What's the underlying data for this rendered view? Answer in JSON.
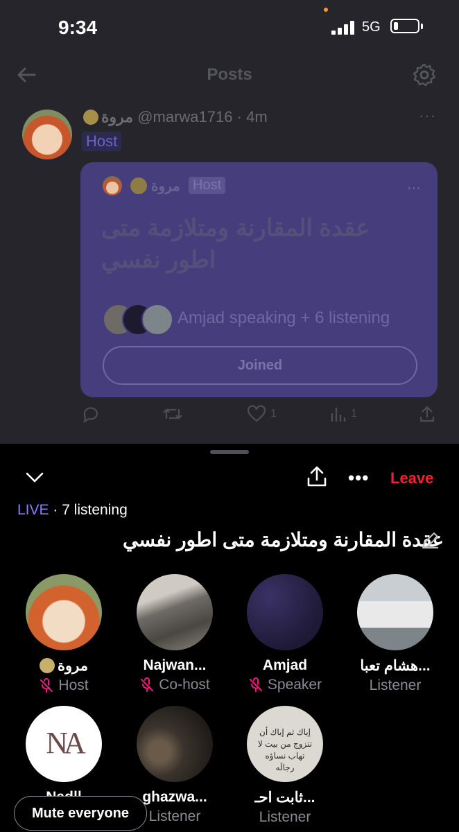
{
  "status_bar": {
    "time": "9:34",
    "network": "5G"
  },
  "nav": {
    "title": "Posts"
  },
  "post": {
    "author_name": "مروة",
    "handle": "@marwa1716",
    "dot": "·",
    "age": "4m",
    "host_label": "Host",
    "more": "···",
    "card": {
      "author_name": "مروة",
      "host_label": "Host",
      "more": "···",
      "title": "عقدة المقارنة ومتلازمة متى اطور نفسي",
      "speaking": "Amjad speaking + 6 listening",
      "joined_label": "Joined"
    },
    "actions": {
      "likes": "1",
      "views": "1"
    }
  },
  "space": {
    "leave_label": "Leave",
    "live_label": "LIVE",
    "listening_text": "· 7 listening",
    "title": "عقدة المقارنة ومتلازمة متى اطور نفسي",
    "participants": [
      {
        "name": "مروة",
        "role": "Host",
        "muted": true,
        "color": "#c7562c"
      },
      {
        "name": "Najwan...",
        "role": "Co-host",
        "muted": true,
        "color": "#6e6b66"
      },
      {
        "name": "Amjad",
        "role": "Speaker",
        "muted": true,
        "color": "#2b2548"
      },
      {
        "name": "هشام تعبا...",
        "role": "Listener",
        "muted": false,
        "color": "#9aa1a8"
      },
      {
        "name": "Nad||",
        "role": "Listener",
        "muted": false,
        "color": "#ffffff"
      },
      {
        "name": "ghazwa...",
        "role": "Listener",
        "muted": false,
        "color": "#3a332d"
      },
      {
        "name": "ثابت احـ...",
        "role": "Listener",
        "muted": false,
        "color": "#dcd9d2"
      }
    ],
    "logo_text": "NA",
    "quote_text": "إياك ثم إياك أن تتزوج من بيت لا تهاب نساؤه رجالَه",
    "mute_everyone_label": "Mute everyone"
  },
  "colors": {
    "accent_live": "#8b7df6",
    "leave_red": "#f4212e",
    "mic_off_pink": "#f91880"
  }
}
